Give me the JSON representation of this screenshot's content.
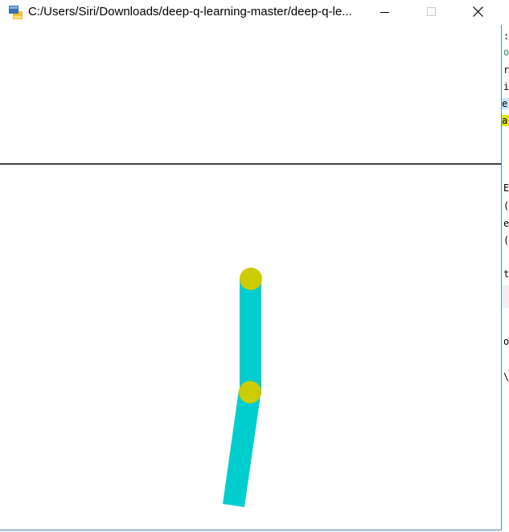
{
  "window": {
    "title": "C:/Users/Siri/Downloads/deep-q-learning-master/deep-q-le...",
    "icons": {
      "app": "python-icon",
      "minimize": "minimize-icon",
      "maximize": "maximize-icon",
      "close": "close-icon"
    }
  },
  "scene": {
    "pendulum_color": "#00cece",
    "joint_color": "#cccc00",
    "ground_line_color": "#000000"
  },
  "background_editor": {
    "lines": [
      ":",
      "o",
      "r",
      "i",
      "e",
      "a",
      "E",
      "(",
      "e",
      "(",
      "t",
      "o",
      "\\"
    ]
  }
}
